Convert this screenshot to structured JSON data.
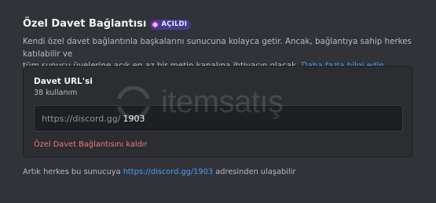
{
  "section": {
    "title": "Özel Davet Bağlantısı",
    "badge": {
      "icon": "boost-gem-icon",
      "label": "AÇILDI",
      "color": "#443a8f"
    },
    "description_line1": "Kendi özel davet bağlantınla başkalarını sunucuna kolayca getir. Ancak, bağlantıya sahip herkes katılabilir ve",
    "description_line2": "tüm sunucu üyelerine açık en az bir metin kanalına ihtiyacın olacak.",
    "learn_more": "Daha fazla bilgi edin."
  },
  "card": {
    "title": "Davet URL'si",
    "usage": "38 kullanım",
    "input": {
      "prefix": "https://discord.gg/",
      "value": "1903"
    },
    "remove_label": "Özel Davet Bağlantısını kaldır"
  },
  "footer": {
    "text_before": "Artık herkes bu sunucuya",
    "link": "https://discord.gg/1903",
    "text_after": "adresinden ulaşabilir"
  },
  "watermark": {
    "text": "itemsatış"
  },
  "colors": {
    "background": "#313338",
    "card": "#2b2d31",
    "link": "#4b9af7",
    "danger": "#f0787a"
  }
}
